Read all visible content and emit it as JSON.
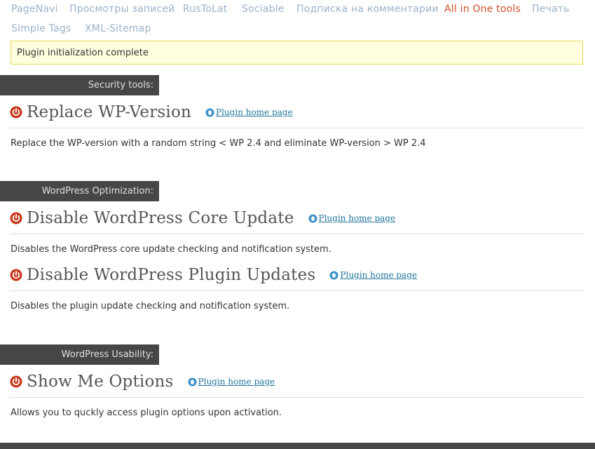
{
  "nav": {
    "items": [
      {
        "label": "PageNavi"
      },
      {
        "label": "Просмотры записей"
      },
      {
        "label": "RusToLat"
      },
      {
        "label": "Sociable"
      },
      {
        "label": "Подписка на комментарии"
      },
      {
        "label": "All in One tools"
      },
      {
        "label": "Печать"
      },
      {
        "label": "Simple Tags"
      },
      {
        "label": "XML-Sitemap"
      }
    ],
    "active": "All in One tools"
  },
  "notice": {
    "message": "Plugin initialization complete"
  },
  "sections": [
    {
      "title": "Security tools:",
      "plugins": [
        {
          "name": "Replace WP-Version",
          "link": "Plugin home page",
          "description": "Replace the WP-version with a random string < WP 2.4 and eliminate WP-version > WP 2.4"
        }
      ]
    },
    {
      "title": "WordPress Optimization:",
      "plugins": [
        {
          "name": "Disable WordPress Core Update",
          "link": "Plugin home page",
          "description": "Disables the WordPress core update checking and notification system."
        },
        {
          "name": "Disable WordPress Plugin Updates",
          "link": "Plugin home page",
          "description": "Disables the plugin update checking and notification system."
        }
      ]
    },
    {
      "title": "WordPress Usability:",
      "plugins": [
        {
          "name": "Show Me Options",
          "link": "Plugin home page",
          "description": "Allows you to quckly access plugin options upon activation."
        }
      ]
    }
  ],
  "colors": {
    "section_bar": "#464646",
    "power_icon": "#c8381c",
    "link": "#21759b",
    "notice_bg": "#ffffe0",
    "nav_active": "#d0512a"
  }
}
